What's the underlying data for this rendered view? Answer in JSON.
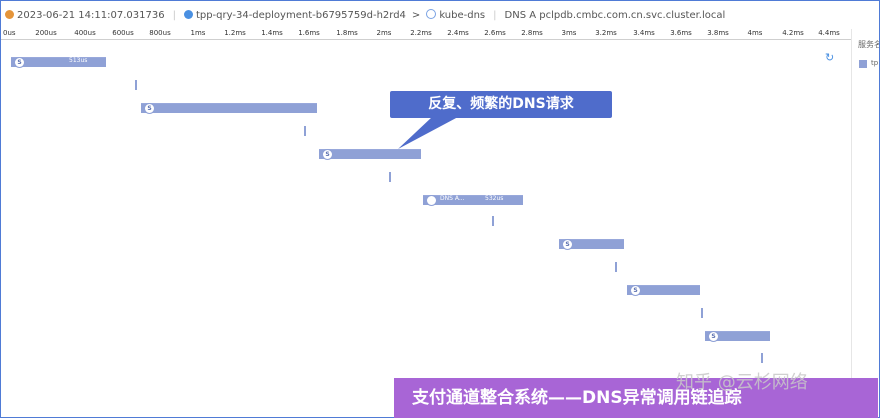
{
  "header": {
    "timestamp": "2023-06-21 14:11:07.031736",
    "service": "tpp-qry-34-deployment-b6795759d-h2rd4",
    "arrow": ">",
    "component": "kube-dns",
    "query": "DNS A pclpdb.cmbc.com.cn.svc.cluster.local"
  },
  "timeline": {
    "ticks": [
      "0us",
      "200us",
      "400us",
      "600us",
      "800us",
      "1ms",
      "1.2ms",
      "1.4ms",
      "1.6ms",
      "1.8ms",
      "2ms",
      "2.2ms",
      "2.4ms",
      "2.6ms",
      "2.8ms",
      "3ms",
      "3.2ms",
      "3.4ms",
      "3.6ms",
      "3.8ms",
      "4ms",
      "4.2ms",
      "4.4ms"
    ]
  },
  "spans": [
    {
      "badge": "S",
      "label": "513us"
    },
    {
      "badge": "S",
      "label": ""
    },
    {
      "badge": "S",
      "label": ""
    },
    {
      "badge": "",
      "label": "DNS A...",
      "label2": "532us"
    },
    {
      "badge": "S",
      "label": ""
    },
    {
      "badge": "S",
      "label": ""
    },
    {
      "badge": "S",
      "label": ""
    }
  ],
  "sidebar": {
    "title": "服务名",
    "item": "tp"
  },
  "callout": "反复、频繁的DNS请求",
  "banner": "支付通道整合系统——DNS异常调用链追踪",
  "watermark": "知乎 @云杉网络",
  "colors": {
    "span": "#8fa1d6",
    "callout": "#4f6ccb",
    "banner": "#a865d6",
    "border": "#4f7bd6"
  }
}
